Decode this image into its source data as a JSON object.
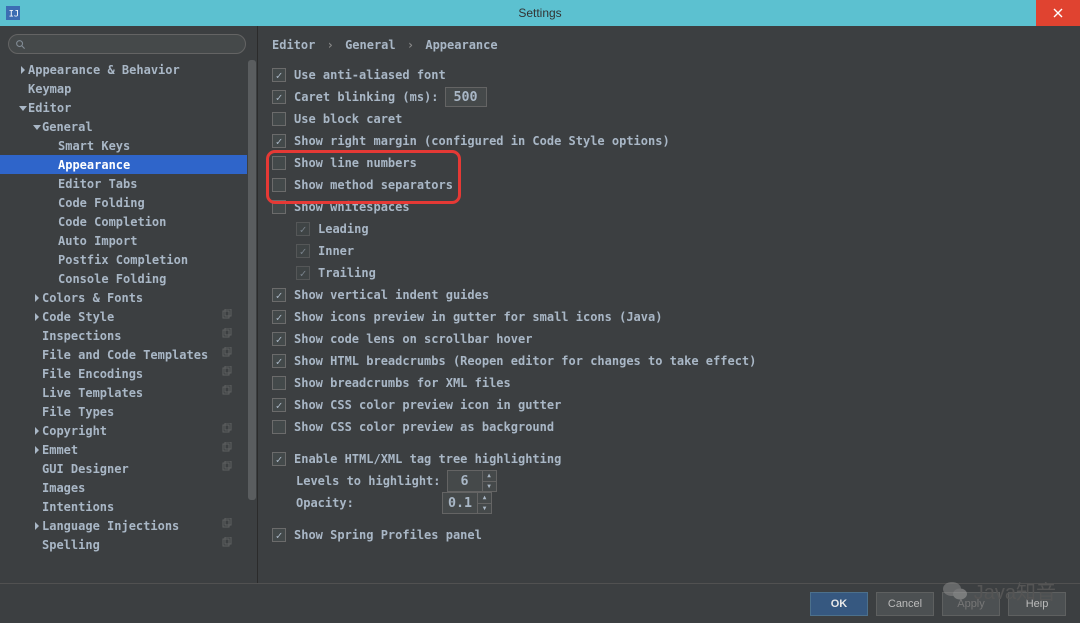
{
  "window": {
    "title": "Settings"
  },
  "breadcrumb": {
    "a": "Editor",
    "b": "General",
    "c": "Appearance",
    "sep": "›"
  },
  "tree": [
    {
      "label": "Appearance & Behavior",
      "indent": 0,
      "arrow": "right",
      "copy": false
    },
    {
      "label": "Keymap",
      "indent": 0,
      "arrow": "",
      "copy": false
    },
    {
      "label": "Editor",
      "indent": 0,
      "arrow": "down",
      "copy": false
    },
    {
      "label": "General",
      "indent": 1,
      "arrow": "down",
      "copy": false
    },
    {
      "label": "Smart Keys",
      "indent": 2,
      "arrow": "",
      "copy": false
    },
    {
      "label": "Appearance",
      "indent": 2,
      "arrow": "",
      "copy": false,
      "selected": true
    },
    {
      "label": "Editor Tabs",
      "indent": 2,
      "arrow": "",
      "copy": false
    },
    {
      "label": "Code Folding",
      "indent": 2,
      "arrow": "",
      "copy": false
    },
    {
      "label": "Code Completion",
      "indent": 2,
      "arrow": "",
      "copy": false
    },
    {
      "label": "Auto Import",
      "indent": 2,
      "arrow": "",
      "copy": false
    },
    {
      "label": "Postfix Completion",
      "indent": 2,
      "arrow": "",
      "copy": false
    },
    {
      "label": "Console Folding",
      "indent": 2,
      "arrow": "",
      "copy": false
    },
    {
      "label": "Colors & Fonts",
      "indent": 1,
      "arrow": "right",
      "copy": false
    },
    {
      "label": "Code Style",
      "indent": 1,
      "arrow": "right",
      "copy": true
    },
    {
      "label": "Inspections",
      "indent": 1,
      "arrow": "",
      "copy": true
    },
    {
      "label": "File and Code Templates",
      "indent": 1,
      "arrow": "",
      "copy": true
    },
    {
      "label": "File Encodings",
      "indent": 1,
      "arrow": "",
      "copy": true
    },
    {
      "label": "Live Templates",
      "indent": 1,
      "arrow": "",
      "copy": true
    },
    {
      "label": "File Types",
      "indent": 1,
      "arrow": "",
      "copy": false
    },
    {
      "label": "Copyright",
      "indent": 1,
      "arrow": "right",
      "copy": true
    },
    {
      "label": "Emmet",
      "indent": 1,
      "arrow": "right",
      "copy": true
    },
    {
      "label": "GUI Designer",
      "indent": 1,
      "arrow": "",
      "copy": true
    },
    {
      "label": "Images",
      "indent": 1,
      "arrow": "",
      "copy": false
    },
    {
      "label": "Intentions",
      "indent": 1,
      "arrow": "",
      "copy": false
    },
    {
      "label": "Language Injections",
      "indent": 1,
      "arrow": "right",
      "copy": true
    },
    {
      "label": "Spelling",
      "indent": 1,
      "arrow": "",
      "copy": true
    }
  ],
  "opts": {
    "antialias": {
      "label": "Use anti-aliased font",
      "checked": true
    },
    "caret_blink": {
      "label": "Caret blinking (ms):",
      "checked": true,
      "value": "500"
    },
    "block_caret": {
      "label": "Use block caret",
      "checked": false
    },
    "right_margin": {
      "label": "Show right margin (configured in Code Style options)",
      "checked": true
    },
    "line_numbers": {
      "label": "Show line numbers",
      "checked": false
    },
    "method_sep": {
      "label": "Show method separators",
      "checked": false
    },
    "whitespace": {
      "label": "Show whitespaces",
      "checked": false
    },
    "ws_leading": {
      "label": "Leading",
      "checked": true,
      "disabled": true
    },
    "ws_inner": {
      "label": "Inner",
      "checked": true,
      "disabled": true
    },
    "ws_trailing": {
      "label": "Trailing",
      "checked": true,
      "disabled": true
    },
    "indent_guides": {
      "label": "Show vertical indent guides",
      "checked": true
    },
    "icons_gutter": {
      "label": "Show icons preview in gutter for small icons (Java)",
      "checked": true
    },
    "code_lens": {
      "label": "Show code lens on scrollbar hover",
      "checked": true
    },
    "html_bc": {
      "label": "Show HTML breadcrumbs (Reopen editor for changes to take effect)",
      "checked": true
    },
    "xml_bc": {
      "label": "Show breadcrumbs for XML files",
      "checked": false
    },
    "css_icon": {
      "label": "Show CSS color preview icon in gutter",
      "checked": true
    },
    "css_bg": {
      "label": "Show CSS color preview as background",
      "checked": false
    },
    "tag_tree": {
      "label": "Enable HTML/XML tag tree highlighting",
      "checked": true
    },
    "levels": {
      "label": "Levels to highlight:",
      "value": "6"
    },
    "opacity": {
      "label": "Opacity:",
      "value": "0.1"
    },
    "spring": {
      "label": "Show Spring Profiles panel",
      "checked": true
    }
  },
  "buttons": {
    "ok": "OK",
    "cancel": "Cancel",
    "apply": "Apply",
    "help": "Help"
  },
  "watermark": "Java知音"
}
